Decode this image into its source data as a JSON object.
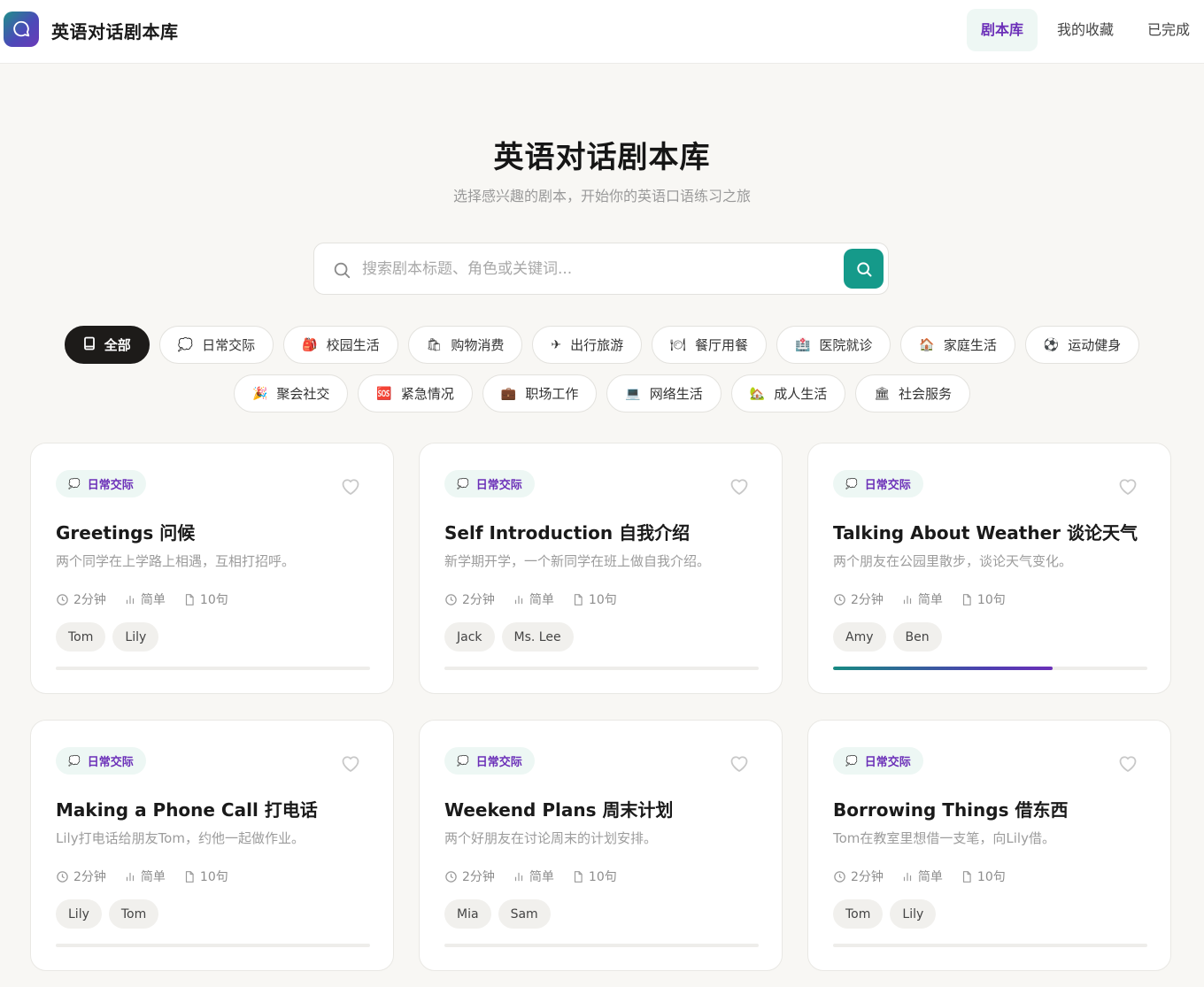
{
  "header": {
    "app_title": "英语对话剧本库",
    "nav": [
      {
        "label": "剧本库",
        "active": true
      },
      {
        "label": "我的收藏",
        "active": false
      },
      {
        "label": "已完成",
        "active": false
      }
    ]
  },
  "hero": {
    "title": "英语对话剧本库",
    "subtitle": "选择感兴趣的剧本，开始你的英语口语练习之旅"
  },
  "search": {
    "placeholder": "搜索剧本标题、角色或关键词...",
    "value": ""
  },
  "categories": [
    {
      "icon": "book-icon",
      "glyph": "",
      "label": "全部",
      "active": true
    },
    {
      "icon": "speech-bubble-icon",
      "glyph": "💭",
      "label": "日常交际",
      "active": false
    },
    {
      "icon": "backpack-icon",
      "glyph": "🎒",
      "label": "校园生活",
      "active": false
    },
    {
      "icon": "shopping-bag-icon",
      "glyph": "🛍",
      "label": "购物消费",
      "active": false
    },
    {
      "icon": "airplane-icon",
      "glyph": "✈",
      "label": "出行旅游",
      "active": false
    },
    {
      "icon": "plate-icon",
      "glyph": "🍽",
      "label": "餐厅用餐",
      "active": false
    },
    {
      "icon": "hospital-icon",
      "glyph": "🏥",
      "label": "医院就诊",
      "active": false
    },
    {
      "icon": "house-icon",
      "glyph": "🏠",
      "label": "家庭生活",
      "active": false
    },
    {
      "icon": "soccer-ball-icon",
      "glyph": "⚽",
      "label": "运动健身",
      "active": false
    },
    {
      "icon": "party-popper-icon",
      "glyph": "🎉",
      "label": "聚会社交",
      "active": false
    },
    {
      "icon": "sos-icon",
      "glyph": "🆘",
      "label": "紧急情况",
      "active": false
    },
    {
      "icon": "briefcase-icon",
      "glyph": "💼",
      "label": "职场工作",
      "active": false
    },
    {
      "icon": "laptop-icon",
      "glyph": "💻",
      "label": "网络生活",
      "active": false
    },
    {
      "icon": "home-garden-icon",
      "glyph": "🏡",
      "label": "成人生活",
      "active": false
    },
    {
      "icon": "bank-icon",
      "glyph": "🏛",
      "label": "社会服务",
      "active": false
    }
  ],
  "cards": [
    {
      "tag": "日常交际",
      "tag_glyph": "💭",
      "title": "Greetings 问候",
      "desc": "两个同学在上学路上相遇，互相打招呼。",
      "duration": "2分钟",
      "level": "简单",
      "lines": "10句",
      "roles": [
        "Tom",
        "Lily"
      ],
      "progress": 0
    },
    {
      "tag": "日常交际",
      "tag_glyph": "💭",
      "title": "Self Introduction 自我介绍",
      "desc": "新学期开学，一个新同学在班上做自我介绍。",
      "duration": "2分钟",
      "level": "简单",
      "lines": "10句",
      "roles": [
        "Jack",
        "Ms. Lee"
      ],
      "progress": 0
    },
    {
      "tag": "日常交际",
      "tag_glyph": "💭",
      "title": "Talking About Weather 谈论天气",
      "desc": "两个朋友在公园里散步，谈论天气变化。",
      "duration": "2分钟",
      "level": "简单",
      "lines": "10句",
      "roles": [
        "Amy",
        "Ben"
      ],
      "progress": 0.7
    },
    {
      "tag": "日常交际",
      "tag_glyph": "💭",
      "title": "Making a Phone Call 打电话",
      "desc": "Lily打电话给朋友Tom，约他一起做作业。",
      "duration": "2分钟",
      "level": "简单",
      "lines": "10句",
      "roles": [
        "Lily",
        "Tom"
      ],
      "progress": 0
    },
    {
      "tag": "日常交际",
      "tag_glyph": "💭",
      "title": "Weekend Plans 周末计划",
      "desc": "两个好朋友在讨论周末的计划安排。",
      "duration": "2分钟",
      "level": "简单",
      "lines": "10句",
      "roles": [
        "Mia",
        "Sam"
      ],
      "progress": 0
    },
    {
      "tag": "日常交际",
      "tag_glyph": "💭",
      "title": "Borrowing Things 借东西",
      "desc": "Tom在教室里想借一支笔，向Lily借。",
      "duration": "2分钟",
      "level": "简单",
      "lines": "10句",
      "roles": [
        "Tom",
        "Lily"
      ],
      "progress": 0
    }
  ],
  "colors": {
    "accent_purple": "#6b2fb8",
    "accent_teal": "#159a8a",
    "background": "#f8f7f4"
  }
}
